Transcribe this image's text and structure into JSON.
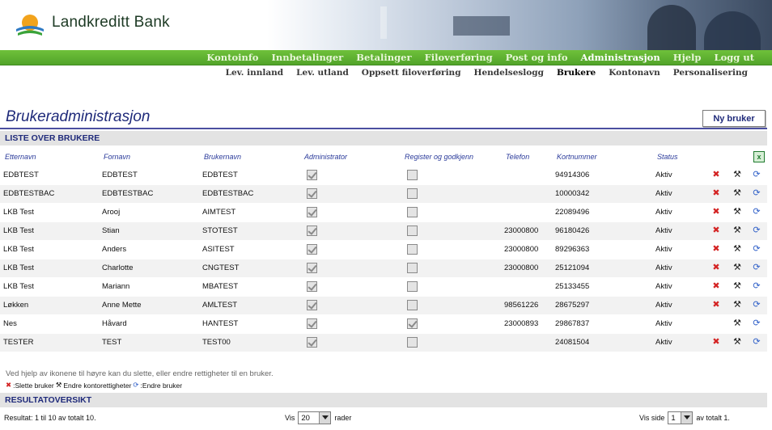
{
  "brand": {
    "name": "Landkreditt Bank"
  },
  "main_nav": [
    {
      "label": "Kontoinfo",
      "active": false
    },
    {
      "label": "Innbetalinger",
      "active": false
    },
    {
      "label": "Betalinger",
      "active": false
    },
    {
      "label": "Filoverføring",
      "active": false
    },
    {
      "label": "Post og info",
      "active": false
    },
    {
      "label": "Administrasjon",
      "active": true
    },
    {
      "label": "Hjelp",
      "active": false
    },
    {
      "label": "Logg ut",
      "active": false
    }
  ],
  "sub_nav": [
    {
      "label": "Lev. innland",
      "active": false
    },
    {
      "label": "Lev. utland",
      "active": false
    },
    {
      "label": "Oppsett filoverføring",
      "active": false
    },
    {
      "label": "Hendelseslogg",
      "active": false
    },
    {
      "label": "Brukere",
      "active": true
    },
    {
      "label": "Kontonavn",
      "active": false
    },
    {
      "label": "Personalisering",
      "active": false
    }
  ],
  "page": {
    "title": "Brukeradministrasjon",
    "new_user_button": "Ny bruker",
    "list_header": "LISTE OVER BRUKERE",
    "results_header": "RESULTATOVERSIKT",
    "excel_icon_label": "x"
  },
  "table": {
    "columns": [
      "Etternavn",
      "Fornavn",
      "Brukernavn",
      "Administrator",
      "Register og godkjenn",
      "Telefon",
      "Kortnummer",
      "Status"
    ],
    "rows": [
      {
        "etternavn": "EDBTEST",
        "fornavn": "EDBTEST",
        "brukernavn": "EDBTEST",
        "admin": true,
        "register": false,
        "telefon": "",
        "kortnummer": "94914306",
        "status": "Aktiv",
        "can_delete": true
      },
      {
        "etternavn": "EDBTESTBAC",
        "fornavn": "EDBTESTBAC",
        "brukernavn": "EDBTESTBAC",
        "admin": true,
        "register": false,
        "telefon": "",
        "kortnummer": "10000342",
        "status": "Aktiv",
        "can_delete": true
      },
      {
        "etternavn": "LKB Test",
        "fornavn": "Arooj",
        "brukernavn": "AIMTEST",
        "admin": true,
        "register": false,
        "telefon": "",
        "kortnummer": "22089496",
        "status": "Aktiv",
        "can_delete": true
      },
      {
        "etternavn": "LKB Test",
        "fornavn": "Stian",
        "brukernavn": "STOTEST",
        "admin": true,
        "register": false,
        "telefon": "23000800",
        "kortnummer": "96180426",
        "status": "Aktiv",
        "can_delete": true
      },
      {
        "etternavn": "LKB Test",
        "fornavn": "Anders",
        "brukernavn": "ASITEST",
        "admin": true,
        "register": false,
        "telefon": "23000800",
        "kortnummer": "89296363",
        "status": "Aktiv",
        "can_delete": true
      },
      {
        "etternavn": "LKB Test",
        "fornavn": "Charlotte",
        "brukernavn": "CNGTEST",
        "admin": true,
        "register": false,
        "telefon": "23000800",
        "kortnummer": "25121094",
        "status": "Aktiv",
        "can_delete": true
      },
      {
        "etternavn": "LKB Test",
        "fornavn": "Mariann",
        "brukernavn": "MBATEST",
        "admin": true,
        "register": false,
        "telefon": "",
        "kortnummer": "25133455",
        "status": "Aktiv",
        "can_delete": true
      },
      {
        "etternavn": "Løkken",
        "fornavn": "Anne Mette",
        "brukernavn": "AMLTEST",
        "admin": true,
        "register": false,
        "telefon": "98561226",
        "kortnummer": "28675297",
        "status": "Aktiv",
        "can_delete": true
      },
      {
        "etternavn": "Nes",
        "fornavn": "Håvard",
        "brukernavn": "HANTEST",
        "admin": true,
        "register": true,
        "telefon": "23000893",
        "kortnummer": "29867837",
        "status": "Aktiv",
        "can_delete": false
      },
      {
        "etternavn": "TESTER",
        "fornavn": "TEST",
        "brukernavn": "TEST00",
        "admin": true,
        "register": false,
        "telefon": "",
        "kortnummer": "24081504",
        "status": "Aktiv",
        "can_delete": true
      }
    ]
  },
  "help": {
    "text": "Ved hjelp av ikonene til høyre kan du slette, eller endre rettigheter til en bruker.",
    "legend_delete": ":Slette bruker",
    "legend_perm": "Endre kontorettigheter",
    "legend_edit": ":Endre bruker"
  },
  "results": {
    "summary": "Resultat: 1 til 10 av totalt 10.",
    "show_label": "Vis",
    "rows_per_page": "20",
    "rows_label": "rader",
    "page_label": "Vis side",
    "page_value": "1",
    "page_total": "av totalt 1."
  },
  "icons": {
    "delete": "delete-icon",
    "permissions": "wrench-icon",
    "edit": "refresh-icon",
    "excel": "excel-icon"
  },
  "colors": {
    "nav_green": "#5cb032",
    "title_blue": "#1f2a7a",
    "header_text_blue": "#2a3a9a",
    "delete_red": "#d42424",
    "edit_blue": "#2e5fc8"
  }
}
